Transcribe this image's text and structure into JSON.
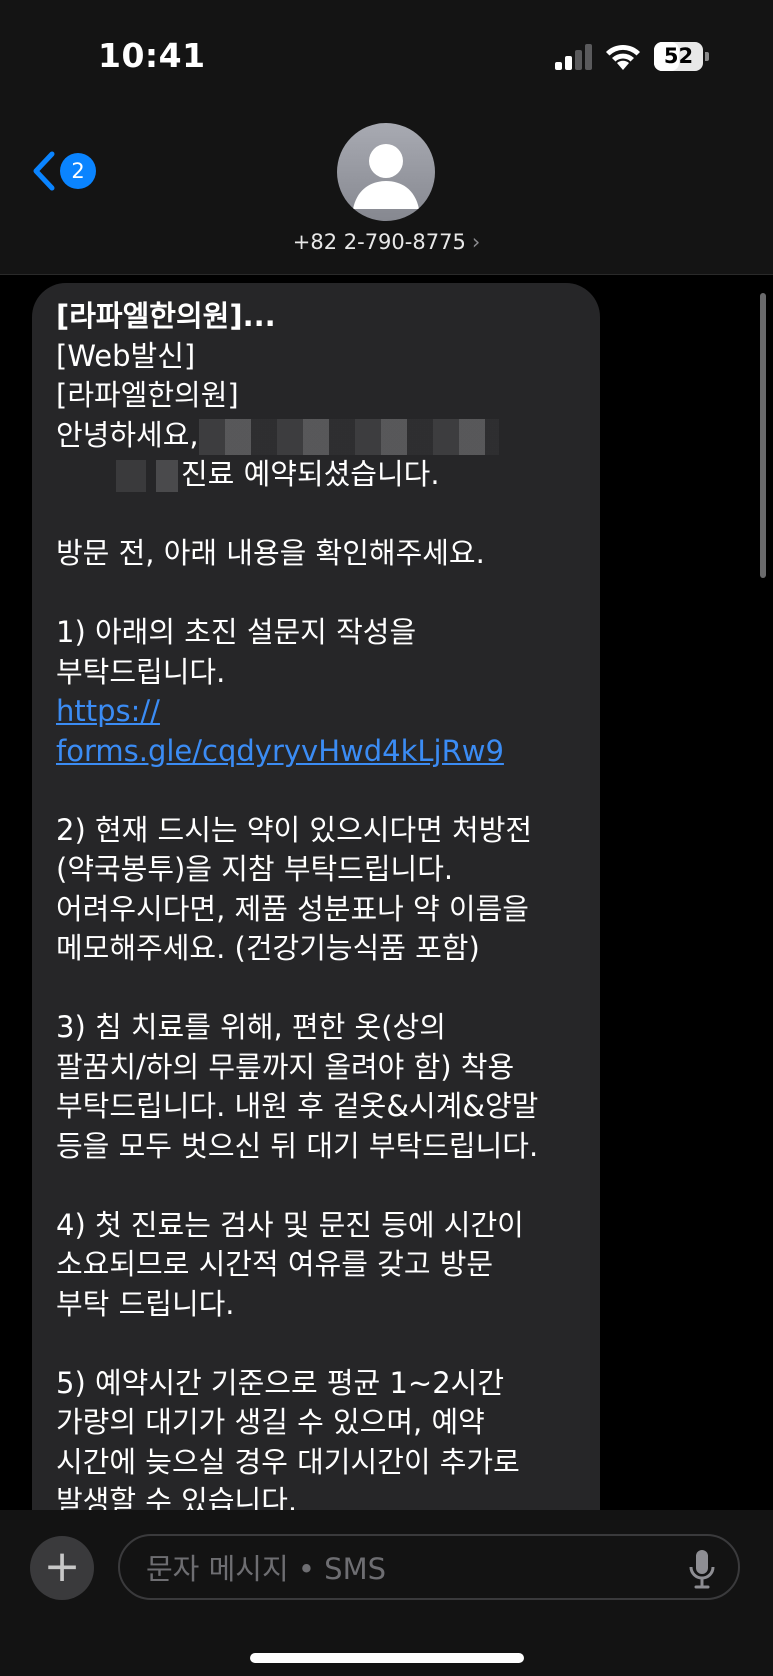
{
  "status_bar": {
    "time": "10:41",
    "battery_percent": "52",
    "battery_level": 0.52,
    "signal_bars_active": 2,
    "signal_bars_total": 4
  },
  "header": {
    "back_badge": "2",
    "contact_number": "+82 2-790-8775",
    "contact_chevron": "›"
  },
  "message": {
    "lines": [
      {
        "text": "[라파엘한의원]...",
        "style": "bold"
      },
      {
        "text": "[Web발신]"
      },
      {
        "text": "[라파엘한의원]"
      },
      {
        "text": "안녕하세요,",
        "redact_after": true
      },
      {
        "text": "진료 예약되셨습니다.",
        "redact_before": true
      },
      {
        "text": ""
      },
      {
        "text": "방문 전, 아래 내용을 확인해주세요."
      },
      {
        "text": ""
      },
      {
        "text": "1) 아래의 초진 설문지 작성을"
      },
      {
        "text": "부탁드립니다."
      },
      {
        "text": "https://",
        "style": "link"
      },
      {
        "text": "forms.gle/cqdyryvHwd4kLjRw9",
        "style": "link"
      },
      {
        "text": ""
      },
      {
        "text": "2) 현재 드시는 약이 있으시다면 처방전"
      },
      {
        "text": "(약국봉투)을 지참 부탁드립니다."
      },
      {
        "text": "어려우시다면, 제품 성분표나 약 이름을"
      },
      {
        "text": "메모해주세요. (건강기능식품 포함)"
      },
      {
        "text": ""
      },
      {
        "text": "3) 침 치료를 위해, 편한 옷(상의"
      },
      {
        "text": "팔꿈치/하의 무릎까지 올려야 함) 착용"
      },
      {
        "text": "부탁드립니다. 내원 후 겉옷&시계&양말"
      },
      {
        "text": "등을 모두 벗으신 뒤 대기 부탁드립니다."
      },
      {
        "text": ""
      },
      {
        "text": "4) 첫 진료는 검사 및 문진 등에 시간이"
      },
      {
        "text": "소요되므로 시간적 여유를 갖고 방문"
      },
      {
        "text": "부탁 드립니다."
      },
      {
        "text": ""
      },
      {
        "text": "5) 예약시간 기준으로 평균 1~2시간"
      },
      {
        "text": "가량의 대기가 생길 수 있으며, 예약"
      },
      {
        "text": "시간에 늦으실 경우 대기시간이 추가로"
      },
      {
        "text": "발생할 수 있습니다."
      }
    ]
  },
  "composer": {
    "placeholder": "문자 메시지 • SMS",
    "plus_label": "+"
  },
  "colors": {
    "accent": "#0a84ff",
    "link": "#3b8cf4",
    "bubble": "#262628",
    "background": "#000000"
  },
  "icons": {
    "back": "chevron-left-icon",
    "avatar": "person-icon",
    "signal": "cellular-signal-icon",
    "wifi": "wifi-icon",
    "battery": "battery-icon",
    "mic": "microphone-icon",
    "plus": "plus-icon"
  }
}
